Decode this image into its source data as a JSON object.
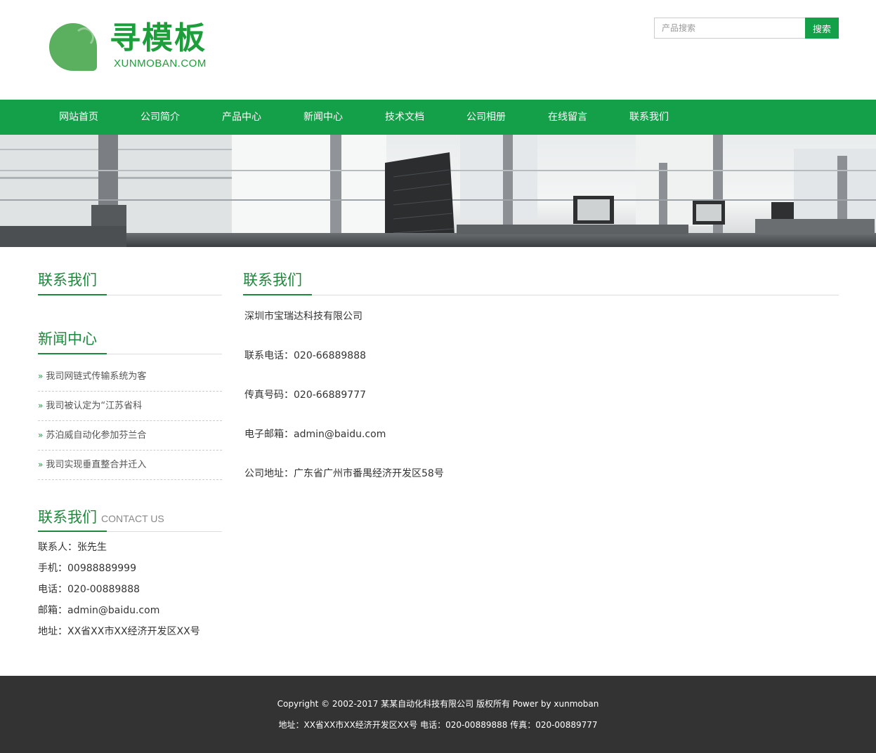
{
  "logo": {
    "cn": "寻模板",
    "en": "XUNMOBAN.COM"
  },
  "search": {
    "placeholder": "产品搜索",
    "button": "搜索"
  },
  "nav": {
    "items": [
      "网站首页",
      "公司简介",
      "产品中心",
      "新闻中心",
      "技术文档",
      "公司相册",
      "在线留言",
      "联系我们"
    ]
  },
  "sidebar": {
    "section1_title": "联系我们",
    "news_title": "新闻中心",
    "news": [
      "我司网链式传输系统为客",
      "我司被认定为“江苏省科",
      "苏泊威自动化参加芬兰合",
      "我司实现垂直整合并迁入"
    ],
    "contact_title": "联系我们",
    "contact_title_en": "CONTACT US",
    "contact": [
      "联系人：张先生",
      "手机：00988889999",
      "电话：020-00889888",
      "邮箱：admin@baidu.com",
      "地址：XX省XX市XX经济开发区XX号"
    ]
  },
  "main": {
    "title": "联系我们",
    "lines": [
      "深圳市宝瑞达科技有限公司",
      "联系电话：020-66889888",
      "传真号码：020-66889777",
      "电子邮箱：admin@baidu.com",
      "公司地址：广东省广州市番禺经济开发区58号"
    ]
  },
  "footer": {
    "line1": "Copyright © 2002-2017 某某自动化科技有限公司 版权所有 Power by xunmoban",
    "line2": "地址：XX省XX市XX经济开发区XX号 电话：020-00889888 传真：020-00889777"
  },
  "colors": {
    "brand_green": "#14a048",
    "heading_green": "#1c8a3c",
    "footer_bg": "#333333"
  }
}
